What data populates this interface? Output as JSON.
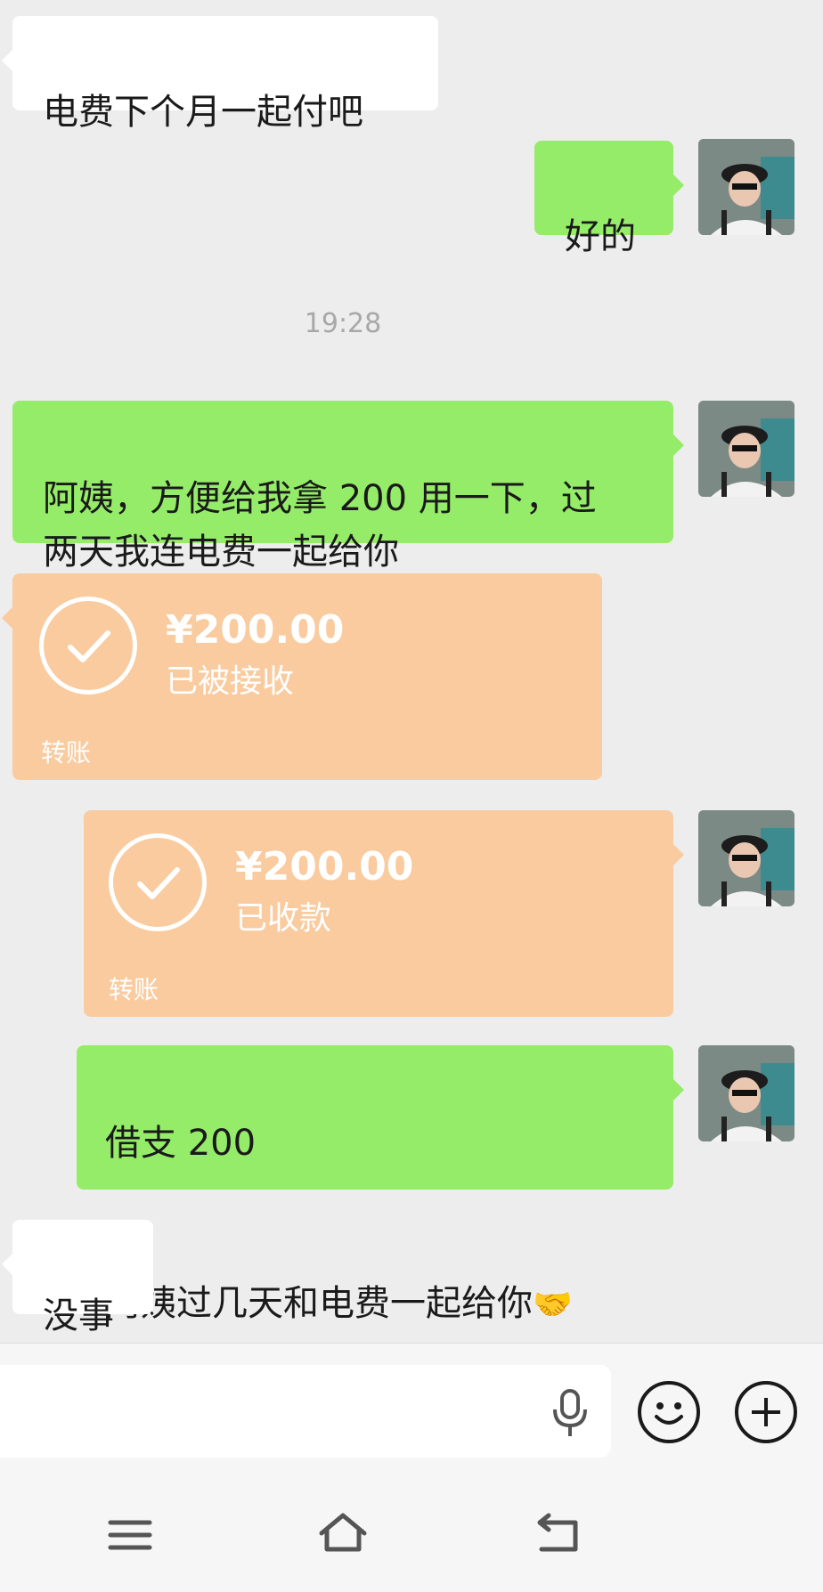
{
  "messages": {
    "m1": "电费下个月一起付吧",
    "m2": "好的",
    "time": "19:28",
    "m3": "阿姨，方便给我拿 200 用一下，过\n两天我连电费一起给你",
    "transfer1": {
      "amount": "¥200.00",
      "status": "已被接收",
      "label": "转账"
    },
    "transfer2": {
      "amount": "¥200.00",
      "status": "已收款",
      "label": "转账"
    },
    "m4_line1": "借支 200",
    "m4_line2": "阿姨过几天和电费一起给你",
    "m4_emoji": "🤝",
    "m5": "没事"
  },
  "icons": {
    "voice": "microphone-icon",
    "emoji": "smiley-icon",
    "more": "plus-icon",
    "nav_menu": "menu-icon",
    "nav_home": "home-icon",
    "nav_back": "back-icon"
  },
  "colors": {
    "bg": "#ededed",
    "green_bubble": "#95ec69",
    "white_bubble": "#ffffff",
    "transfer_bubble": "#f9cb9f",
    "timestamp": "#a8a8a8"
  }
}
